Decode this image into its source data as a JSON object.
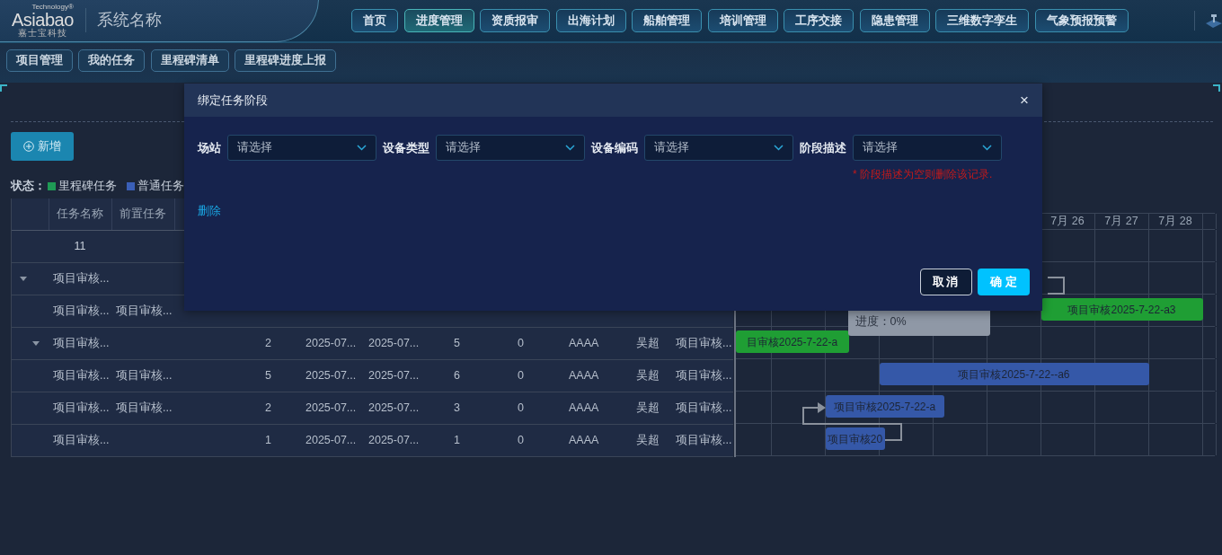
{
  "header": {
    "logo": {
      "brand": "Asiabao",
      "tagline": "Technology®",
      "subtitle": "嘉士宝科技"
    },
    "system_name": "系统名称",
    "nav": [
      {
        "label": "首页",
        "selected": false
      },
      {
        "label": "进度管理",
        "selected": true
      },
      {
        "label": "资质报审",
        "selected": false
      },
      {
        "label": "出海计划",
        "selected": false
      },
      {
        "label": "船舶管理",
        "selected": false
      },
      {
        "label": "培训管理",
        "selected": false
      },
      {
        "label": "工序交接",
        "selected": false
      },
      {
        "label": "隐患管理",
        "selected": false
      },
      {
        "label": "三维数字孪生",
        "selected": false
      },
      {
        "label": "气象预报预警",
        "selected": false
      }
    ]
  },
  "subnav": [
    {
      "label": "项目管理"
    },
    {
      "label": "我的任务"
    },
    {
      "label": "里程碑清单"
    },
    {
      "label": "里程碑进度上报"
    }
  ],
  "toolbar": {
    "add_button": "新增"
  },
  "legend": {
    "label": "状态：",
    "items": [
      {
        "label": "里程碑任务",
        "color": "#1f9a55"
      },
      {
        "label": "普通任务",
        "color": "#3a5fb8"
      }
    ]
  },
  "table": {
    "columns": [
      "任务名称",
      "前置任务"
    ],
    "group_row": "11",
    "rows": [
      {
        "name": "项目审核...",
        "expanded": true,
        "children": [
          {
            "name": "项目审核...",
            "predecessor": "项目审核..."
          },
          {
            "name": "项目审核...",
            "expanded": true,
            "values": [
              "2",
              "2025-07...",
              "2025-07...",
              "5",
              "0",
              "AAAA",
              "吴超",
              "项目审核..."
            ],
            "children": [
              {
                "name": "项目审核...",
                "predecessor": "项目审核...",
                "values": [
                  "5",
                  "2025-07...",
                  "2025-07...",
                  "6",
                  "0",
                  "AAAA",
                  "吴超",
                  "项目审核..."
                ]
              },
              {
                "name": "项目审核...",
                "predecessor": "项目审核...",
                "values": [
                  "2",
                  "2025-07...",
                  "2025-07...",
                  "3",
                  "0",
                  "AAAA",
                  "吴超",
                  "项目审核..."
                ]
              }
            ]
          }
        ]
      },
      {
        "name": "项目审核...",
        "values": [
          "1",
          "2025-07...",
          "2025-07...",
          "1",
          "0",
          "AAAA",
          "吴超",
          "项目审核..."
        ]
      }
    ]
  },
  "gantt": {
    "days": [
      "7月 26",
      "7月 27",
      "7月 28"
    ],
    "bars": [
      {
        "text": "项目审核2025-7-22-a3",
        "kind": "milestone"
      },
      {
        "text": "目审核2025-7-22-a",
        "kind": "milestone"
      },
      {
        "text": "项目审核2025-7-22--a6",
        "kind": "normal"
      },
      {
        "text": "项目审核2025-7-22-a",
        "kind": "normal"
      },
      {
        "text": "项目审核20",
        "kind": "normal"
      }
    ],
    "tooltip": {
      "text": "进度：0%"
    }
  },
  "modal": {
    "title": "绑定任务阶段",
    "close": "×",
    "fields": [
      {
        "label": "场站",
        "placeholder": "请选择"
      },
      {
        "label": "设备类型",
        "placeholder": "请选择"
      },
      {
        "label": "设备编码",
        "placeholder": "请选择"
      },
      {
        "label": "阶段描述",
        "placeholder": "请选择",
        "hint": "* 阶段描述为空则删除该记录."
      }
    ],
    "delete_link": "删除",
    "cancel_button": "取消",
    "confirm_button": "确 定"
  }
}
